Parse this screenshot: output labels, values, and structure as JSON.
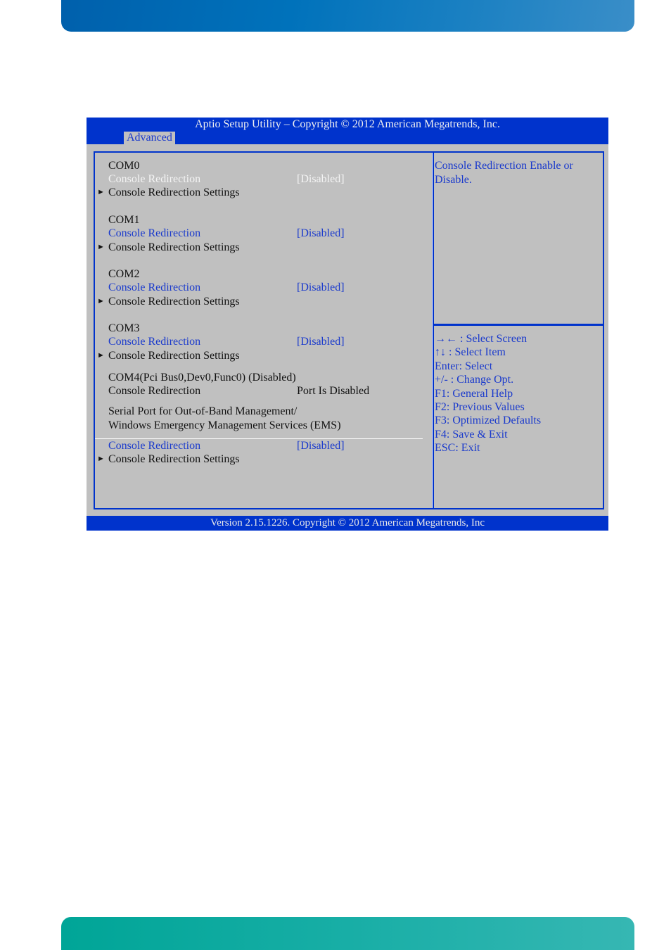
{
  "bios": {
    "title": "Aptio Setup Utility  –  Copyright © 2012 American Megatrends, Inc.",
    "active_tab": "Advanced",
    "footer": "Version 2.15.1226. Copyright © 2012 American Megatrends, Inc",
    "colors": {
      "header_bg": "#0033cc",
      "panel_bg": "#c0c0c0",
      "selectable_text": "#1a3acc",
      "highlighted_text": "#f4f4f4"
    },
    "com0": {
      "title": "COM0",
      "redirection_label": "Console Redirection",
      "redirection_value": "[Disabled]",
      "settings_label": "Console Redirection Settings"
    },
    "com1": {
      "title": "COM1",
      "redirection_label": "Console Redirection",
      "redirection_value": "[Disabled]",
      "settings_label": "Console Redirection Settings"
    },
    "com2": {
      "title": "COM2",
      "redirection_label": "Console Redirection",
      "redirection_value": "[Disabled]",
      "settings_label": "Console Redirection Settings"
    },
    "com3": {
      "title": "COM3",
      "redirection_label": "Console Redirection",
      "redirection_value": "[Disabled]",
      "settings_label": "Console Redirection Settings"
    },
    "com4": {
      "title": "COM4(Pci Bus0,Dev0,Func0)  (Disabled)",
      "redirection_label": "Console Redirection",
      "redirection_value": "Port Is Disabled"
    },
    "ems": {
      "heading_line1": "Serial Port for Out-of-Band Management/",
      "heading_line2": "Windows Emergency Management Services (EMS)",
      "redirection_label": "Console Redirection",
      "redirection_value": "[Disabled]",
      "settings_label": "Console Redirection Settings"
    },
    "submenu_arrow": "►",
    "help": {
      "description": "Console Redirection Enable or Disable.",
      "keys": [
        "→← : Select Screen",
        "↑↓ : Select Item",
        "Enter: Select",
        "+/- : Change Opt.",
        "F1: General Help",
        "F2: Previous Values",
        "F3: Optimized Defaults",
        "F4: Save & Exit",
        "ESC: Exit"
      ]
    }
  }
}
